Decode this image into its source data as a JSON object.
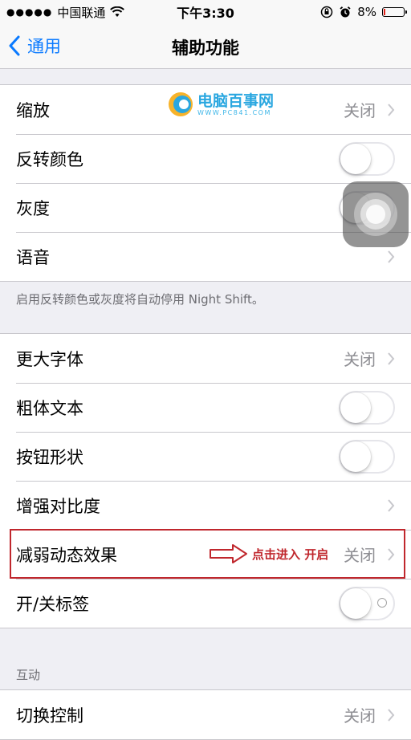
{
  "status_bar": {
    "carrier": "中国联通",
    "time": "下午3:30",
    "battery_percent": "8%",
    "battery_level": 0.08,
    "battery_color": "#e2231a"
  },
  "nav": {
    "back_label": "通用",
    "title": "辅助功能",
    "accent_color": "#0a7aff"
  },
  "group1": {
    "zoom": {
      "label": "缩放",
      "value": "关闭"
    },
    "invert_colors": {
      "label": "反转颜色",
      "on": false
    },
    "grayscale": {
      "label": "灰度",
      "on": false
    },
    "speech": {
      "label": "语音"
    }
  },
  "group1_footer": "启用反转颜色或灰度将自动停用 Night Shift。",
  "group2": {
    "larger_text": {
      "label": "更大字体",
      "value": "关闭"
    },
    "bold_text": {
      "label": "粗体文本",
      "on": false
    },
    "button_shapes": {
      "label": "按钮形状",
      "on": false
    },
    "increase_contrast": {
      "label": "增强对比度"
    },
    "reduce_motion": {
      "label": "减弱动态效果",
      "value": "关闭"
    },
    "on_off_labels": {
      "label": "开/关标签",
      "on": false
    }
  },
  "annotation": {
    "text": "点击进入 开启",
    "color": "#c0272d"
  },
  "interaction_header": "互动",
  "group3": {
    "switch_control": {
      "label": "切换控制",
      "value": "关闭"
    }
  },
  "watermark": {
    "main": "电脑百事网",
    "sub": "WWW.PC841.COM"
  }
}
